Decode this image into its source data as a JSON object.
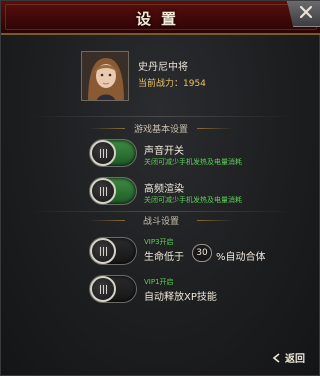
{
  "window": {
    "title": "设置"
  },
  "profile": {
    "name": "史丹尼中将",
    "power": "当前战力：1954"
  },
  "sections": {
    "basic": "游戏基本设置",
    "battle": "战斗设置"
  },
  "options": {
    "sound": {
      "title": "声音开关",
      "desc": "关闭可减少手机发热及电量消耗",
      "state": "on"
    },
    "hq_render": {
      "title": "高频渲染",
      "desc": "关闭可减少手机发热及电量消耗",
      "state": "on"
    },
    "auto_merge": {
      "vip": "VIP3开启",
      "prefix": "生命低于",
      "value": "30",
      "suffix": "%自动合体",
      "state": "off"
    },
    "auto_xp": {
      "vip": "VIP1开启",
      "title": "自动释放XP技能",
      "state": "off"
    }
  },
  "footer": {
    "back": "返回"
  },
  "colors": {
    "accent_green": "#5fcf5a",
    "power_gold": "#e8c36a",
    "title_red": "#3d0808"
  },
  "icons": {
    "close": "close-icon",
    "back": "chevron-left-icon",
    "grip": "grip-lines-icon"
  }
}
